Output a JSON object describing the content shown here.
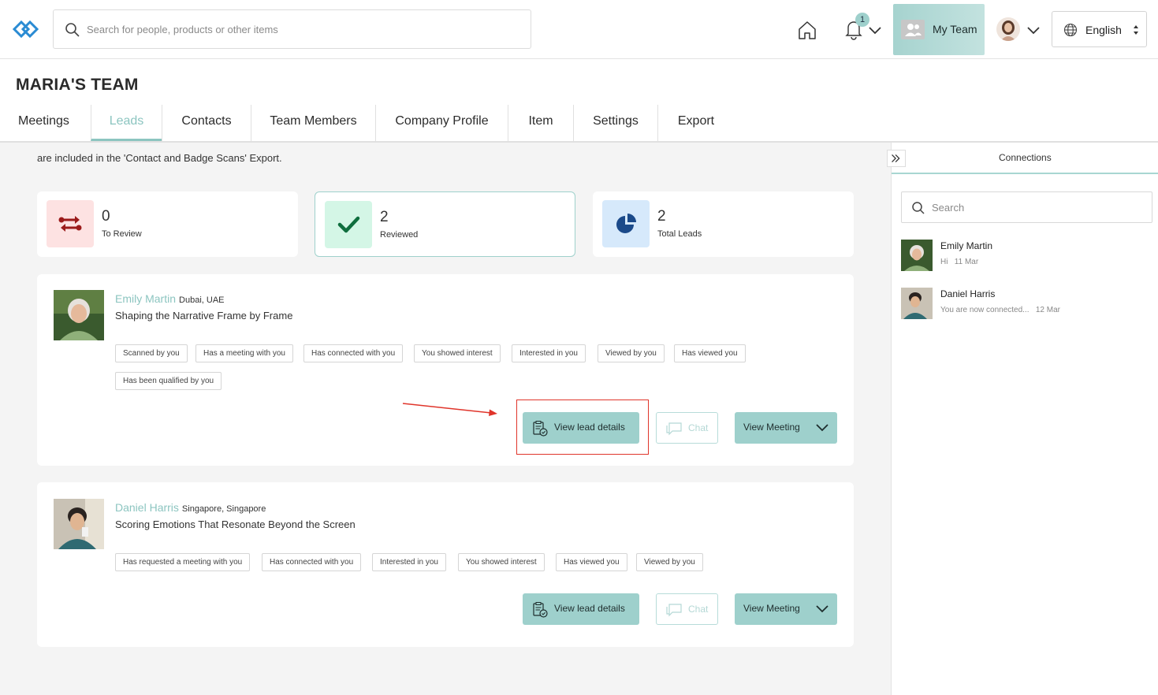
{
  "search": {
    "placeholder": "Search for people, products or other items"
  },
  "header": {
    "notification_count": "1",
    "my_team_label": "My Team",
    "language": "English"
  },
  "team_title": "MARIA'S TEAM",
  "tabs": [
    "Meetings",
    "Leads",
    "Contacts",
    "Team Members",
    "Company Profile",
    "Item",
    "Settings",
    "Export"
  ],
  "active_tab": "Leads",
  "intro_text": "are included in the 'Contact and Badge Scans' Export.",
  "stats": [
    {
      "value": "0",
      "label": "To Review",
      "color": "#fde2e2"
    },
    {
      "value": "2",
      "label": "Reviewed",
      "color": "#d4f6e6"
    },
    {
      "value": "2",
      "label": "Total Leads",
      "color": "#d6e9fb"
    }
  ],
  "leads": [
    {
      "name": "Emily Martin",
      "location": "Dubai, UAE",
      "title": "Shaping the Narrative Frame by Frame",
      "tags": [
        "Scanned by you",
        "Has a meeting with you",
        "Has connected with you",
        "You showed interest",
        "Interested in you",
        "Viewed by you",
        "Has viewed you",
        "Has been qualified by you"
      ]
    },
    {
      "name": "Daniel Harris",
      "location": "Singapore, Singapore",
      "title": "Scoring Emotions That Resonate Beyond the Screen",
      "tags": [
        "Has requested a meeting with you",
        "Has connected with you",
        "Interested in you",
        "You showed interest",
        "Has viewed you",
        "Viewed by you"
      ]
    }
  ],
  "buttons": {
    "view_lead": "View lead details",
    "chat": "Chat",
    "view_meeting": "View Meeting"
  },
  "connections": {
    "title": "Connections",
    "search_placeholder": "Search",
    "items": [
      {
        "name": "Emily Martin",
        "message": "Hi",
        "date": "11 Mar"
      },
      {
        "name": "Daniel Harris",
        "message": "You are now connected...",
        "date": "12 Mar"
      }
    ]
  },
  "colors": {
    "accent": "#8cc5c0",
    "button": "#9ed0cc",
    "highlight": "#e0352b"
  }
}
